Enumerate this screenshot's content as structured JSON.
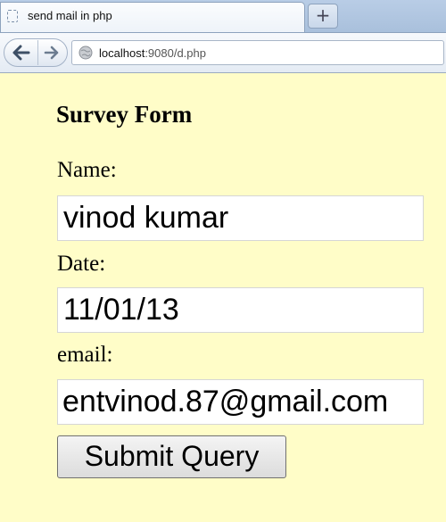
{
  "browser": {
    "tab": {
      "title": "send mail in php"
    },
    "new_tab_label": "+",
    "url": {
      "host": "localhost",
      "rest": ":9080/d.php"
    }
  },
  "form": {
    "title": "Survey Form",
    "fields": [
      {
        "label": "Name:",
        "value": "vinod kumar"
      },
      {
        "label": "Date:",
        "value": "11/01/13"
      },
      {
        "label": "email:",
        "value": "entvinod.87@gmail.com"
      }
    ],
    "submit_label": "Submit Query"
  },
  "colors": {
    "page_background": "#fffdc8",
    "chrome": "#b9cde6"
  }
}
